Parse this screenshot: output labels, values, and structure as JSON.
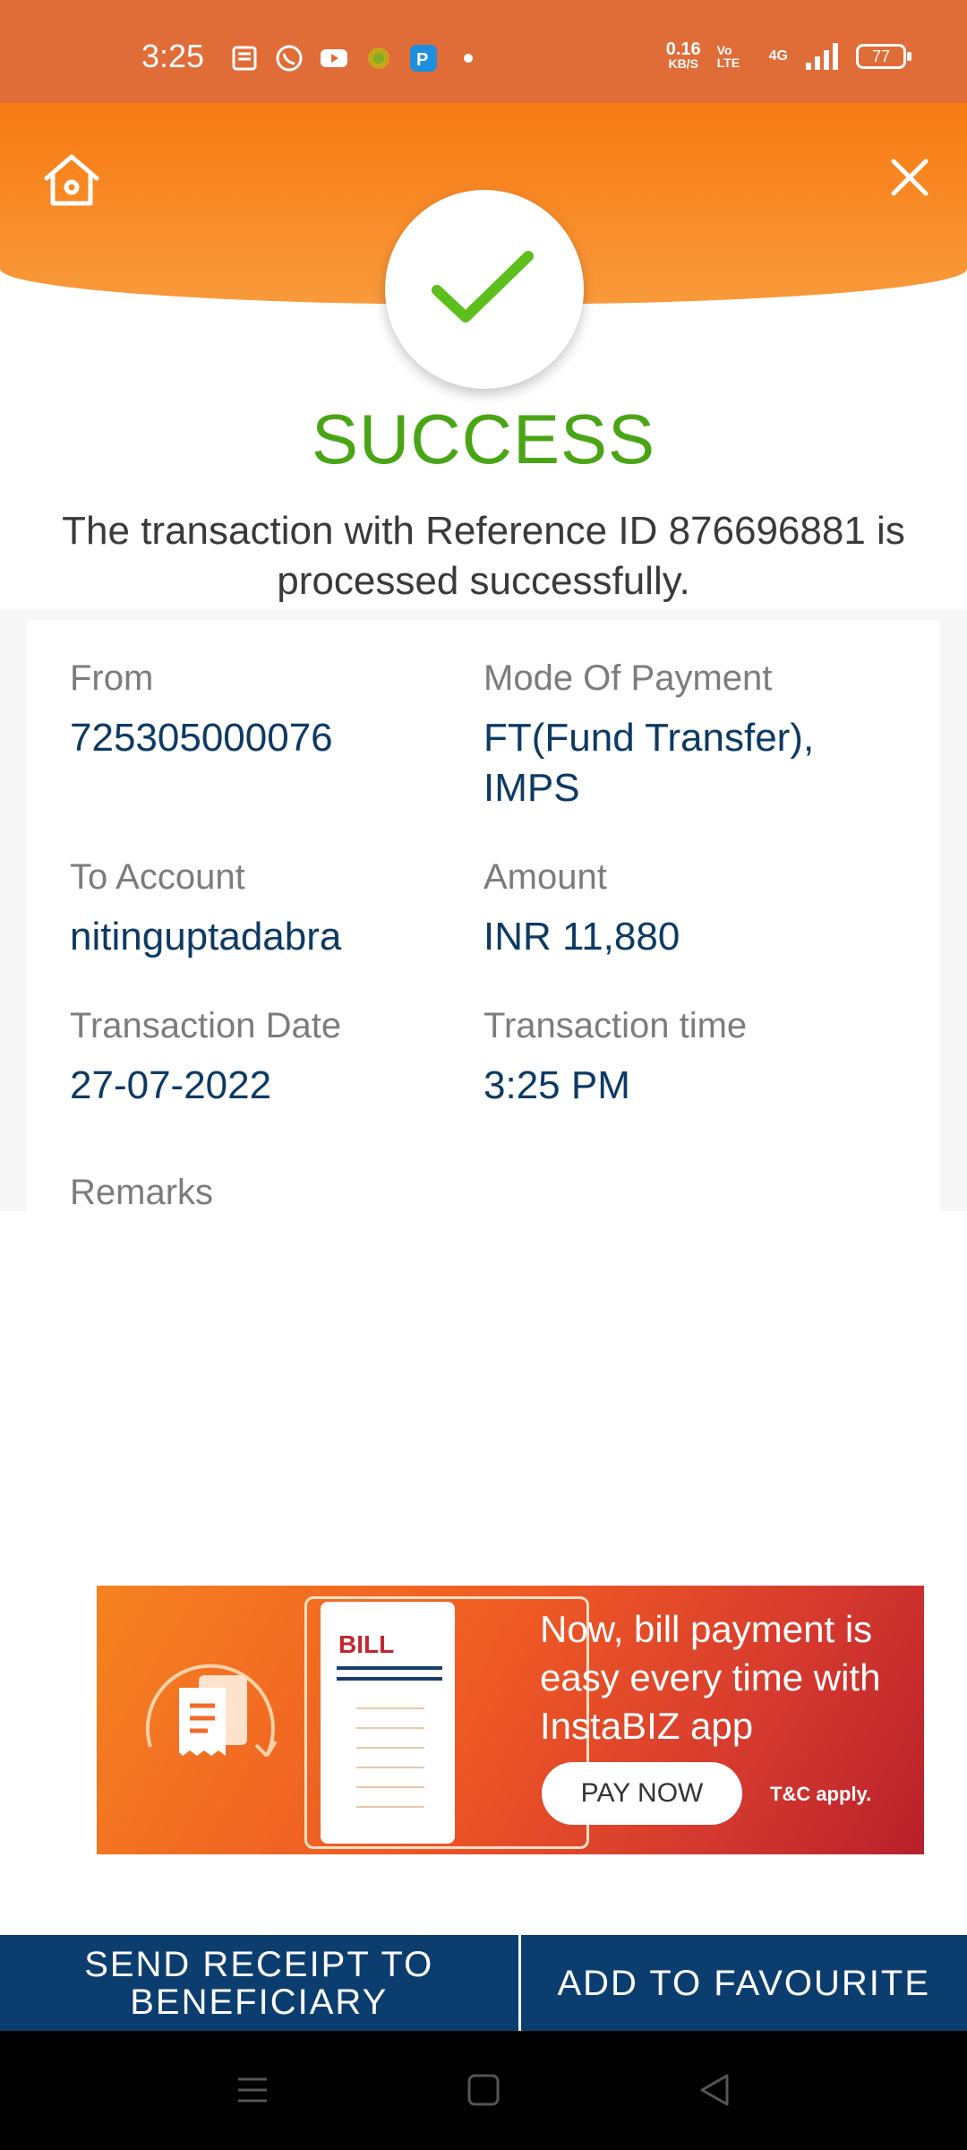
{
  "status_bar": {
    "time": "3:25",
    "net_speed_value": "0.16",
    "net_speed_unit": "KB/S",
    "volte": "Vo LTE",
    "network": "4G",
    "battery": "77"
  },
  "header": {
    "home_icon": "home-icon",
    "close_icon": "close-icon"
  },
  "result": {
    "title": "SUCCESS",
    "message": "The transaction with Reference ID 876696881 is processed successfully."
  },
  "details": {
    "from_label": "From",
    "from_value": "725305000076",
    "mode_label": "Mode Of Payment",
    "mode_value": "FT(Fund Transfer), IMPS",
    "to_label": "To Account",
    "to_value": "nitinguptadabra",
    "amount_label": "Amount",
    "amount_value": "INR 11,880",
    "date_label": "Transaction Date",
    "date_value": "27-07-2022",
    "time_label": "Transaction time",
    "time_value": "3:25 PM",
    "remarks_label": "Remarks"
  },
  "banner": {
    "bill_label": "BILL",
    "text": "Now, bill payment is easy every time with InstaBIZ app",
    "button": "PAY NOW",
    "terms": "T&C apply."
  },
  "actions": {
    "send_receipt": "SEND RECEIPT TO BENEFICIARY",
    "add_favourite": "ADD TO FAVOURITE"
  },
  "colors": {
    "accent_orange": "#f77a12",
    "success_green": "#4aa516",
    "primary_blue": "#0c3d6f"
  }
}
